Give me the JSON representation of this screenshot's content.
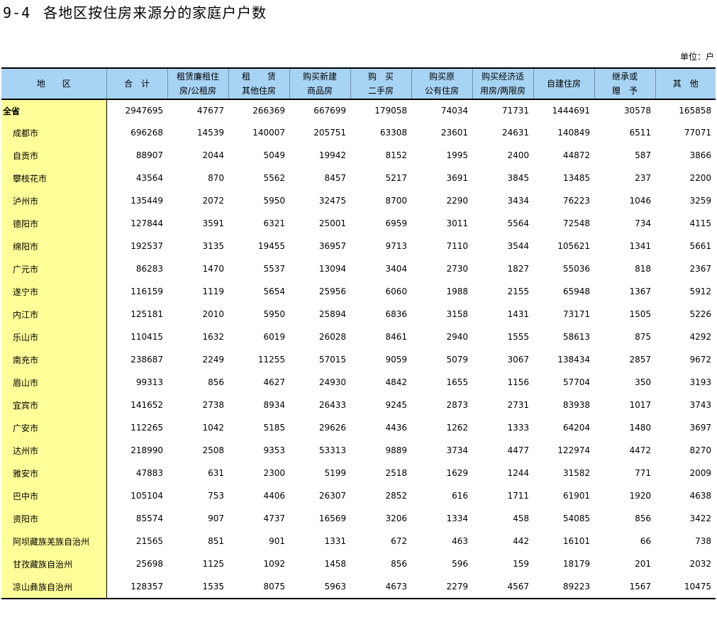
{
  "title": {
    "number": "9-4",
    "text": "各地区按住房来源分的家庭户户数"
  },
  "unit": "单位：户",
  "headers": [
    [
      "地　　区"
    ],
    [
      "合　计"
    ],
    [
      "租赁廉租住",
      "房/公租房"
    ],
    [
      "租　　赁",
      "其他住房"
    ],
    [
      "购买新建",
      "商品房"
    ],
    [
      "购　买",
      "二手房"
    ],
    [
      "购买原",
      "公有住房"
    ],
    [
      "购买经济适",
      "用房/两限房"
    ],
    [
      "自建住房"
    ],
    [
      "继承或",
      "赠　予"
    ],
    [
      "其　他"
    ]
  ],
  "rows": [
    [
      "全省",
      "2947695",
      "47677",
      "266369",
      "667699",
      "179058",
      "74034",
      "71731",
      "1444691",
      "30578",
      "165858"
    ],
    [
      "成都市",
      "696268",
      "14539",
      "140007",
      "205751",
      "63308",
      "23601",
      "24631",
      "140849",
      "6511",
      "77071"
    ],
    [
      "自贡市",
      "88907",
      "2044",
      "5049",
      "19942",
      "8152",
      "1995",
      "2400",
      "44872",
      "587",
      "3866"
    ],
    [
      "攀枝花市",
      "43564",
      "870",
      "5562",
      "8457",
      "5217",
      "3691",
      "3845",
      "13485",
      "237",
      "2200"
    ],
    [
      "泸州市",
      "135449",
      "2072",
      "5950",
      "32475",
      "8700",
      "2290",
      "3434",
      "76223",
      "1046",
      "3259"
    ],
    [
      "德阳市",
      "127844",
      "3591",
      "6321",
      "25001",
      "6959",
      "3011",
      "5564",
      "72548",
      "734",
      "4115"
    ],
    [
      "绵阳市",
      "192537",
      "3135",
      "19455",
      "36957",
      "9713",
      "7110",
      "3544",
      "105621",
      "1341",
      "5661"
    ],
    [
      "广元市",
      "86283",
      "1470",
      "5537",
      "13094",
      "3404",
      "2730",
      "1827",
      "55036",
      "818",
      "2367"
    ],
    [
      "遂宁市",
      "116159",
      "1119",
      "5654",
      "25956",
      "6060",
      "1988",
      "2155",
      "65948",
      "1367",
      "5912"
    ],
    [
      "内江市",
      "125181",
      "2010",
      "5950",
      "25894",
      "6836",
      "3158",
      "1431",
      "73171",
      "1505",
      "5226"
    ],
    [
      "乐山市",
      "110415",
      "1632",
      "6019",
      "26028",
      "8461",
      "2940",
      "1555",
      "58613",
      "875",
      "4292"
    ],
    [
      "南充市",
      "238687",
      "2249",
      "11255",
      "57015",
      "9059",
      "5079",
      "3067",
      "138434",
      "2857",
      "9672"
    ],
    [
      "眉山市",
      "99313",
      "856",
      "4627",
      "24930",
      "4842",
      "1655",
      "1156",
      "57704",
      "350",
      "3193"
    ],
    [
      "宜宾市",
      "141652",
      "2738",
      "8934",
      "26433",
      "9245",
      "2873",
      "2731",
      "83938",
      "1017",
      "3743"
    ],
    [
      "广安市",
      "112265",
      "1042",
      "5185",
      "29626",
      "4436",
      "1262",
      "1333",
      "64204",
      "1480",
      "3697"
    ],
    [
      "达州市",
      "218990",
      "2508",
      "9353",
      "53313",
      "9889",
      "3734",
      "4477",
      "122974",
      "4472",
      "8270"
    ],
    [
      "雅安市",
      "47883",
      "631",
      "2300",
      "5199",
      "2518",
      "1629",
      "1244",
      "31582",
      "771",
      "2009"
    ],
    [
      "巴中市",
      "105104",
      "753",
      "4406",
      "26307",
      "2852",
      "616",
      "1711",
      "61901",
      "1920",
      "4638"
    ],
    [
      "资阳市",
      "85574",
      "907",
      "4737",
      "16569",
      "3206",
      "1334",
      "458",
      "54085",
      "856",
      "3422"
    ],
    [
      "阿坝藏族羌族自治州",
      "21565",
      "851",
      "901",
      "1331",
      "672",
      "463",
      "442",
      "16101",
      "66",
      "738"
    ],
    [
      "甘孜藏族自治州",
      "25698",
      "1125",
      "1092",
      "1458",
      "856",
      "596",
      "159",
      "18179",
      "201",
      "2032"
    ],
    [
      "凉山彝族自治州",
      "128357",
      "1535",
      "8075",
      "5963",
      "4673",
      "2279",
      "4567",
      "89223",
      "1567",
      "10475"
    ]
  ]
}
